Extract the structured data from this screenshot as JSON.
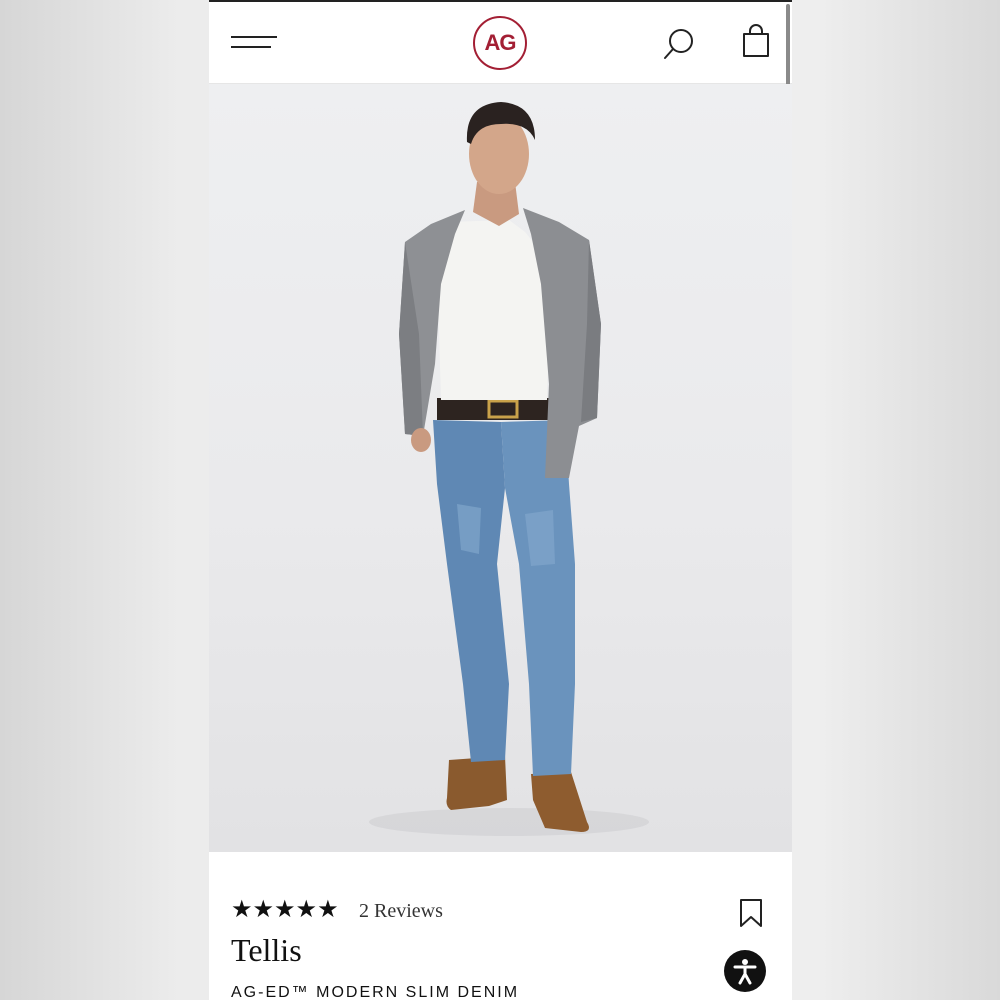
{
  "header": {
    "logo_text": "AG",
    "brand_color": "#a31f34",
    "menu_icon": "hamburger-menu-icon",
    "search_icon": "search-icon",
    "bag_icon": "shopping-bag-icon"
  },
  "product": {
    "rating": 5,
    "stars": "★★★★★",
    "reviews_label": "2 Reviews",
    "name": "Tellis",
    "subtitle": "AG-ED™ MODERN SLIM DENIM",
    "bookmark_icon": "bookmark-icon"
  },
  "accessibility": {
    "icon": "accessibility-icon"
  }
}
